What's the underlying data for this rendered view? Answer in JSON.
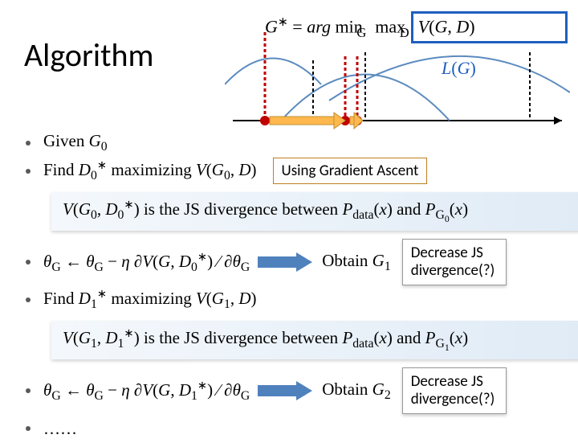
{
  "title": "Algorithm",
  "top_formula_html": "<i>G</i><sup>∗</sup> = <i>arg</i> min<sub style='margin-left:-28px'> &nbsp;&nbsp;&nbsp;&nbsp;G</sub>&nbsp; max<sub style='margin-left:-28px'> &nbsp;&nbsp;&nbsp;&nbsp;D</sub>&nbsp; <i>V</i>(<i>G</i>, <i>D</i>)",
  "lg_html": "<i>L</i>(<i>G</i>)",
  "gradient_label": "Using Gradient Ascent",
  "callout1": "Decrease JS divergence(?)",
  "callout2": "Decrease JS divergence(?)",
  "b1_html": "Given <i>G</i><sub>0</sub>",
  "b2_html": "Find <i>D</i><sub>0</sub><sup>∗</sup> maximizing <i>V</i>(<i>G</i><sub>0</sub>, <i>D</i>)",
  "band1_html": "<i>V</i>(<i>G</i><sub>0</sub>, <i>D</i><sub>0</sub><sup>∗</sup>) is the JS divergence between <i>P</i><sub>data</sub>(<i>x</i>) and <i>P</i><sub>G<sub>0</sub></sub>(<i>x</i>)",
  "b3_html": "<i>θ</i><sub>G</sub> ← <i>θ</i><sub>G</sub> − <i>η</i> ∂<i>V</i>(<i>G</i>, <i>D</i><sub>0</sub><sup>∗</sup>) ⁄ ∂<i>θ</i><sub>G</sub>",
  "b3_obtain_html": "Obtain <i>G</i><sub>1</sub>",
  "b4_html": "Find <i>D</i><sub>1</sub><sup>∗</sup> maximizing <i>V</i>(<i>G</i><sub>1</sub>, <i>D</i>)",
  "band2_html": "<i>V</i>(<i>G</i><sub>1</sub>, <i>D</i><sub>1</sub><sup>∗</sup>) is the JS divergence between <i>P</i><sub>data</sub>(<i>x</i>) and <i>P</i><sub>G<sub>1</sub></sub>(<i>x</i>)",
  "b5_html": "<i>θ</i><sub>G</sub> ← <i>θ</i><sub>G</sub> − <i>η</i> ∂<i>V</i>(<i>G</i>, <i>D</i><sub>1</sub><sup>∗</sup>) ⁄ ∂<i>θ</i><sub>G</sub>",
  "b5_obtain_html": "Obtain <i>G</i><sub>2</sub>",
  "b6": "……"
}
